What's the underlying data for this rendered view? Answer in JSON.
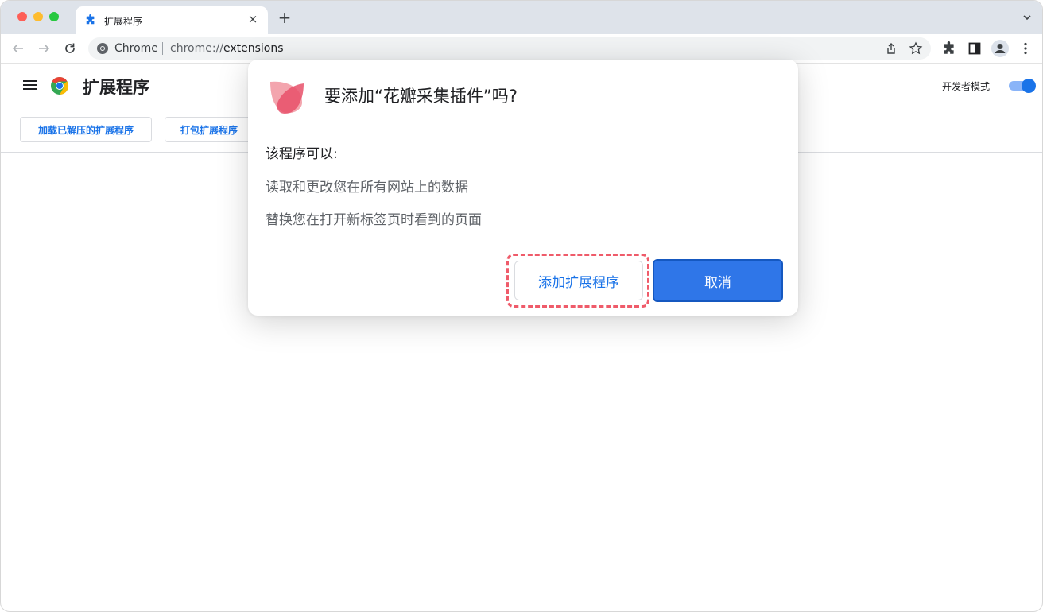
{
  "browser": {
    "tab_title": "扩展程序",
    "new_tab_symbol": "+",
    "close_symbol": "×",
    "omnibox": {
      "scheme_label": "Chrome",
      "url_prefix": "chrome://",
      "url_host": "extensions"
    }
  },
  "page": {
    "title": "扩展程序",
    "developer_mode_label": "开发者模式",
    "developer_mode_on": true,
    "buttons": {
      "load_unpacked": "加载已解压的扩展程序",
      "pack": "打包扩展程序"
    }
  },
  "dialog": {
    "title": "要添加“花瓣采集插件”吗?",
    "subtitle": "该程序可以:",
    "permissions": [
      "读取和更改您在所有网站上的数据",
      "替换您在打开新标签页时看到的页面"
    ],
    "add_button": "添加扩展程序",
    "cancel_button": "取消"
  },
  "colors": {
    "accent": "#1a73e8",
    "cancel_bg": "#2f76e8",
    "highlight": "#ef5b6a",
    "logo": "#e8506a"
  }
}
